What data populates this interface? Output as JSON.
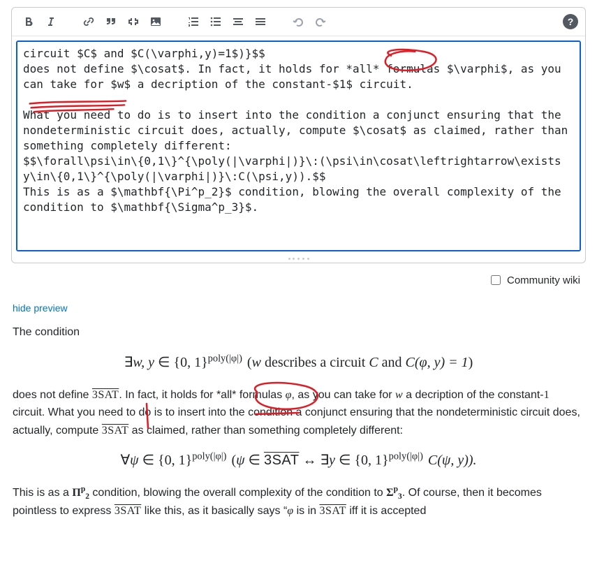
{
  "toolbar": {
    "help_tooltip": "Help"
  },
  "editor": {
    "text": "circuit $C$ and $C(\\varphi,y)=1$)}$$\ndoes not define $\\cosat$. In fact, it holds for *all* formulas $\\varphi$, as you can take for $w$ a decription of the constant-$1$ circuit.\n\nWhat you need to do is to insert into the condition a conjunct ensuring that the nondeterministic circuit does, actually, compute $\\cosat$ as claimed, rather than something completely different:\n$$\\forall\\psi\\in\\{0,1\\}^{\\poly(|\\varphi|)}\\:(\\psi\\in\\cosat\\leftrightarrow\\exists y\\in\\{0,1\\}^{\\poly(|\\varphi|)}\\:C(\\psi,y)).$$\nThis is as a $\\mathbf{\\Pi^p_2}$ condition, blowing the overall complexity of the condition to $\\mathbf{\\Sigma^p_3}$."
  },
  "community_wiki_label": "Community wiki",
  "hide_preview_label": "hide preview",
  "preview": {
    "lead": "The condition",
    "disp1_a": "∃",
    "disp1_b": "w, y",
    "disp1_c": " ∈ {0, 1}",
    "disp1_exp": "poly(|φ|)",
    "disp1_d": " (",
    "disp1_e": "w",
    "disp1_f": " describes a circuit ",
    "disp1_g": "C",
    "disp1_h": " and ",
    "disp1_i": "C(φ, y) = 1",
    "disp1_j": ")",
    "p2_a": "does not define ",
    "cosat": "3SAT",
    "p2_b": ". In fact, it holds for *all* formulas ",
    "phi": "φ",
    "p2_c": ", as you can take for ",
    "w": "w",
    "p2_d": " a decription of the constant-",
    "one": "1",
    "p2_e": " circuit. What you need to do is to insert into the condition a conjunct ensuring that the nondeterministic circuit does, actually, compute ",
    "p2_f": " as claimed, rather than something completely different:",
    "disp2_a": "∀",
    "disp2_b": "ψ",
    "disp2_c": " ∈ {0, 1}",
    "disp2_exp1": "poly(|φ|)",
    "disp2_d": " (",
    "disp2_e": "ψ",
    "disp2_f": " ∈ ",
    "disp2_g": " ↔ ∃",
    "disp2_h": "y",
    "disp2_i": " ∈ {0, 1}",
    "disp2_exp2": "poly(|φ|)",
    "disp2_j": " C(ψ, y)).",
    "p3_a": "This is as a ",
    "pi2p": "Π",
    "pi2p_sup": "p",
    "pi2p_sub": "2",
    "p3_b": " condition, blowing the overall complexity of the condition to ",
    "sigma3p": "Σ",
    "sigma3p_sup": "p",
    "sigma3p_sub": "3",
    "p3_c": ". Of course, then it becomes pointless to express ",
    "p3_d": " like this, as it basically says “",
    "p3_e": " is in ",
    "p3_f": " iff it is accepted"
  }
}
